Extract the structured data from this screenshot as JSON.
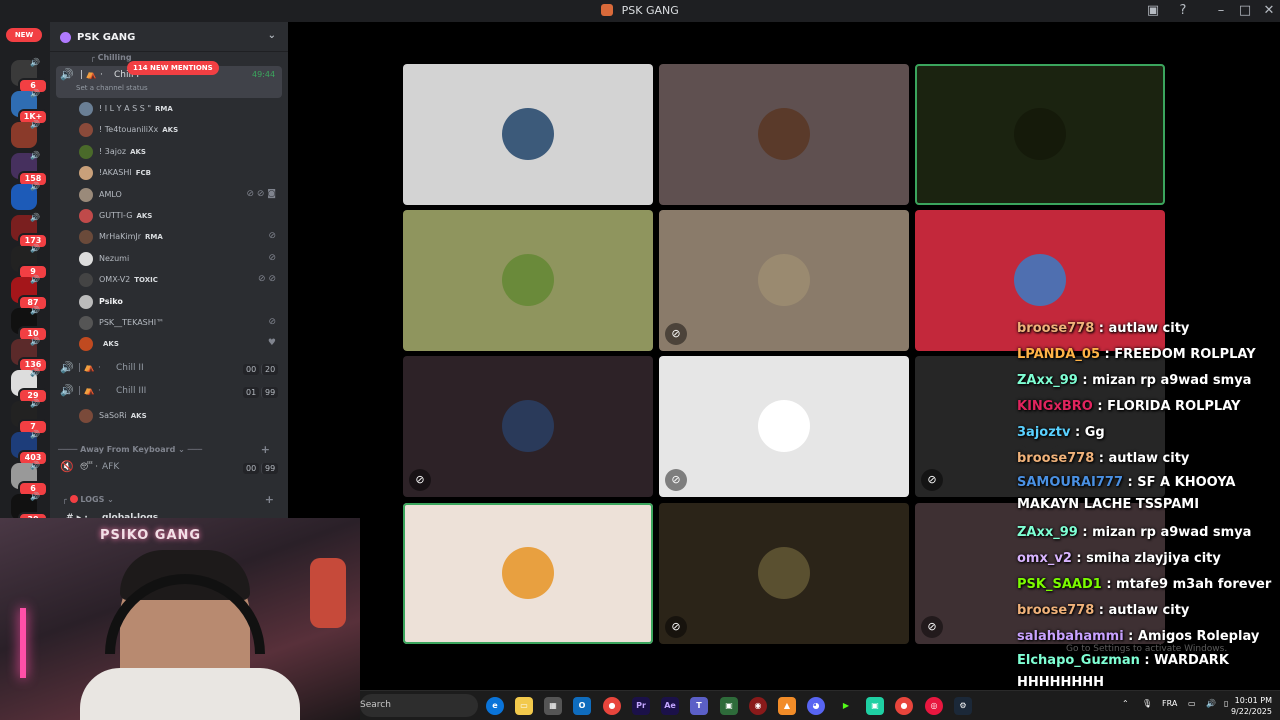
{
  "window": {
    "title": "PSK GANG"
  },
  "rail": {
    "new_label": "NEW",
    "badges": [
      "6",
      "1K+",
      "",
      "158",
      "",
      "173",
      "9",
      "87",
      "10",
      "136",
      "29",
      "7",
      "403",
      "6",
      "30"
    ]
  },
  "guild": {
    "name": "PSK GANG",
    "mentions": "114 NEW MENTIONS",
    "category_top": "Chilling",
    "active_channel": {
      "name": "Chill I",
      "timer": "49:44",
      "status_placeholder": "Set a channel status"
    },
    "members": [
      {
        "name": "! I L Y A S S \"",
        "tag": "RMA"
      },
      {
        "name": "! Te4touaniliXx",
        "tag": "AKS"
      },
      {
        "name": "! 3ajoz",
        "tag": "AKS"
      },
      {
        "name": "!AKASHI",
        "tag": "FCB"
      },
      {
        "name": "AMLO",
        "tag": ""
      },
      {
        "name": "GUTTI-G",
        "tag": "AKS"
      },
      {
        "name": "MrHaKimJr",
        "tag": "RMA"
      },
      {
        "name": "Nezumi",
        "tag": ""
      },
      {
        "name": "OMX-V2",
        "tag": "TOXIC"
      },
      {
        "name": "Psiko",
        "tag": ""
      },
      {
        "name": "PSK__TEKASHI™",
        "tag": ""
      },
      {
        "name": "",
        "tag": "AKS"
      }
    ],
    "voice_channels": [
      {
        "name": "Chill II",
        "count_a": "00",
        "count_b": "20"
      },
      {
        "name": "Chill III",
        "count_a": "01",
        "count_b": "99"
      }
    ],
    "chill3_member": {
      "name": "SaSoRi",
      "tag": "AKS"
    },
    "afk_category": "Away From Keyboard",
    "afk_channel": {
      "name": "AFK",
      "count_a": "00",
      "count_b": "99"
    },
    "logs_category": "LOGS",
    "logs_channel": "global-logs"
  },
  "webcam": {
    "banner": "PSIKO GANG"
  },
  "chat": [
    {
      "user": "broose778",
      "text": " : autlaw city",
      "color": "#f0b27a"
    },
    {
      "user": "LPANDA_05",
      "text": " : FREEDOM ROLPLAY",
      "color": "#ffb347"
    },
    {
      "user": "ZAxx_99",
      "text": " : mizan rp a9wad smya",
      "color": "#7fffd4"
    },
    {
      "user": "KINGxBRO",
      "text": " : FLORIDA ROLPLAY",
      "color": "#e0245e"
    },
    {
      "user": "3ajoztv",
      "text": " : Gg",
      "color": "#5ad1ff"
    },
    {
      "user": "broose778",
      "text": " : autlaw city",
      "color": "#f0b27a"
    },
    {
      "user": "SAMOURAI777",
      "text": " : SF A KHOOYA MAKAYN LACHE TSSPAMI",
      "color": "#4a90e2"
    },
    {
      "user": "ZAxx_99",
      "text": " : mizan rp a9wad smya",
      "color": "#7fffd4"
    },
    {
      "user": "omx_v2",
      "text": " : smiha zlayjiya city",
      "color": "#d8b4fe"
    },
    {
      "user": "PSK_SAAD1",
      "text": " : mtafe9 m3ah forever",
      "color": "#7CFC00"
    },
    {
      "user": "broose778",
      "text": " : autlaw city",
      "color": "#f0b27a"
    },
    {
      "user": "salahbahammi",
      "text": " : Amigos Roleplay",
      "color": "#c8a2ff"
    },
    {
      "user": "Elchapo_Guzman",
      "text": " : WARDARK HHHHHHHH",
      "color": "#7fffd4"
    }
  ],
  "taskbar": {
    "search_label": "Search",
    "lang": "FRA",
    "time": "10:01 PM",
    "date": "9/22/2025",
    "watermark": "Go to Settings to activate Windows."
  },
  "colors": {
    "discord_bg": "#2b2d31",
    "rail_bg": "#1e1f22",
    "speaking": "#3ba55d",
    "mention_red": "#f23f43"
  },
  "icons": [
    "speaker-icon",
    "mic-muted-icon",
    "headphones-deafened-icon",
    "search-icon",
    "chevron-down-icon"
  ]
}
